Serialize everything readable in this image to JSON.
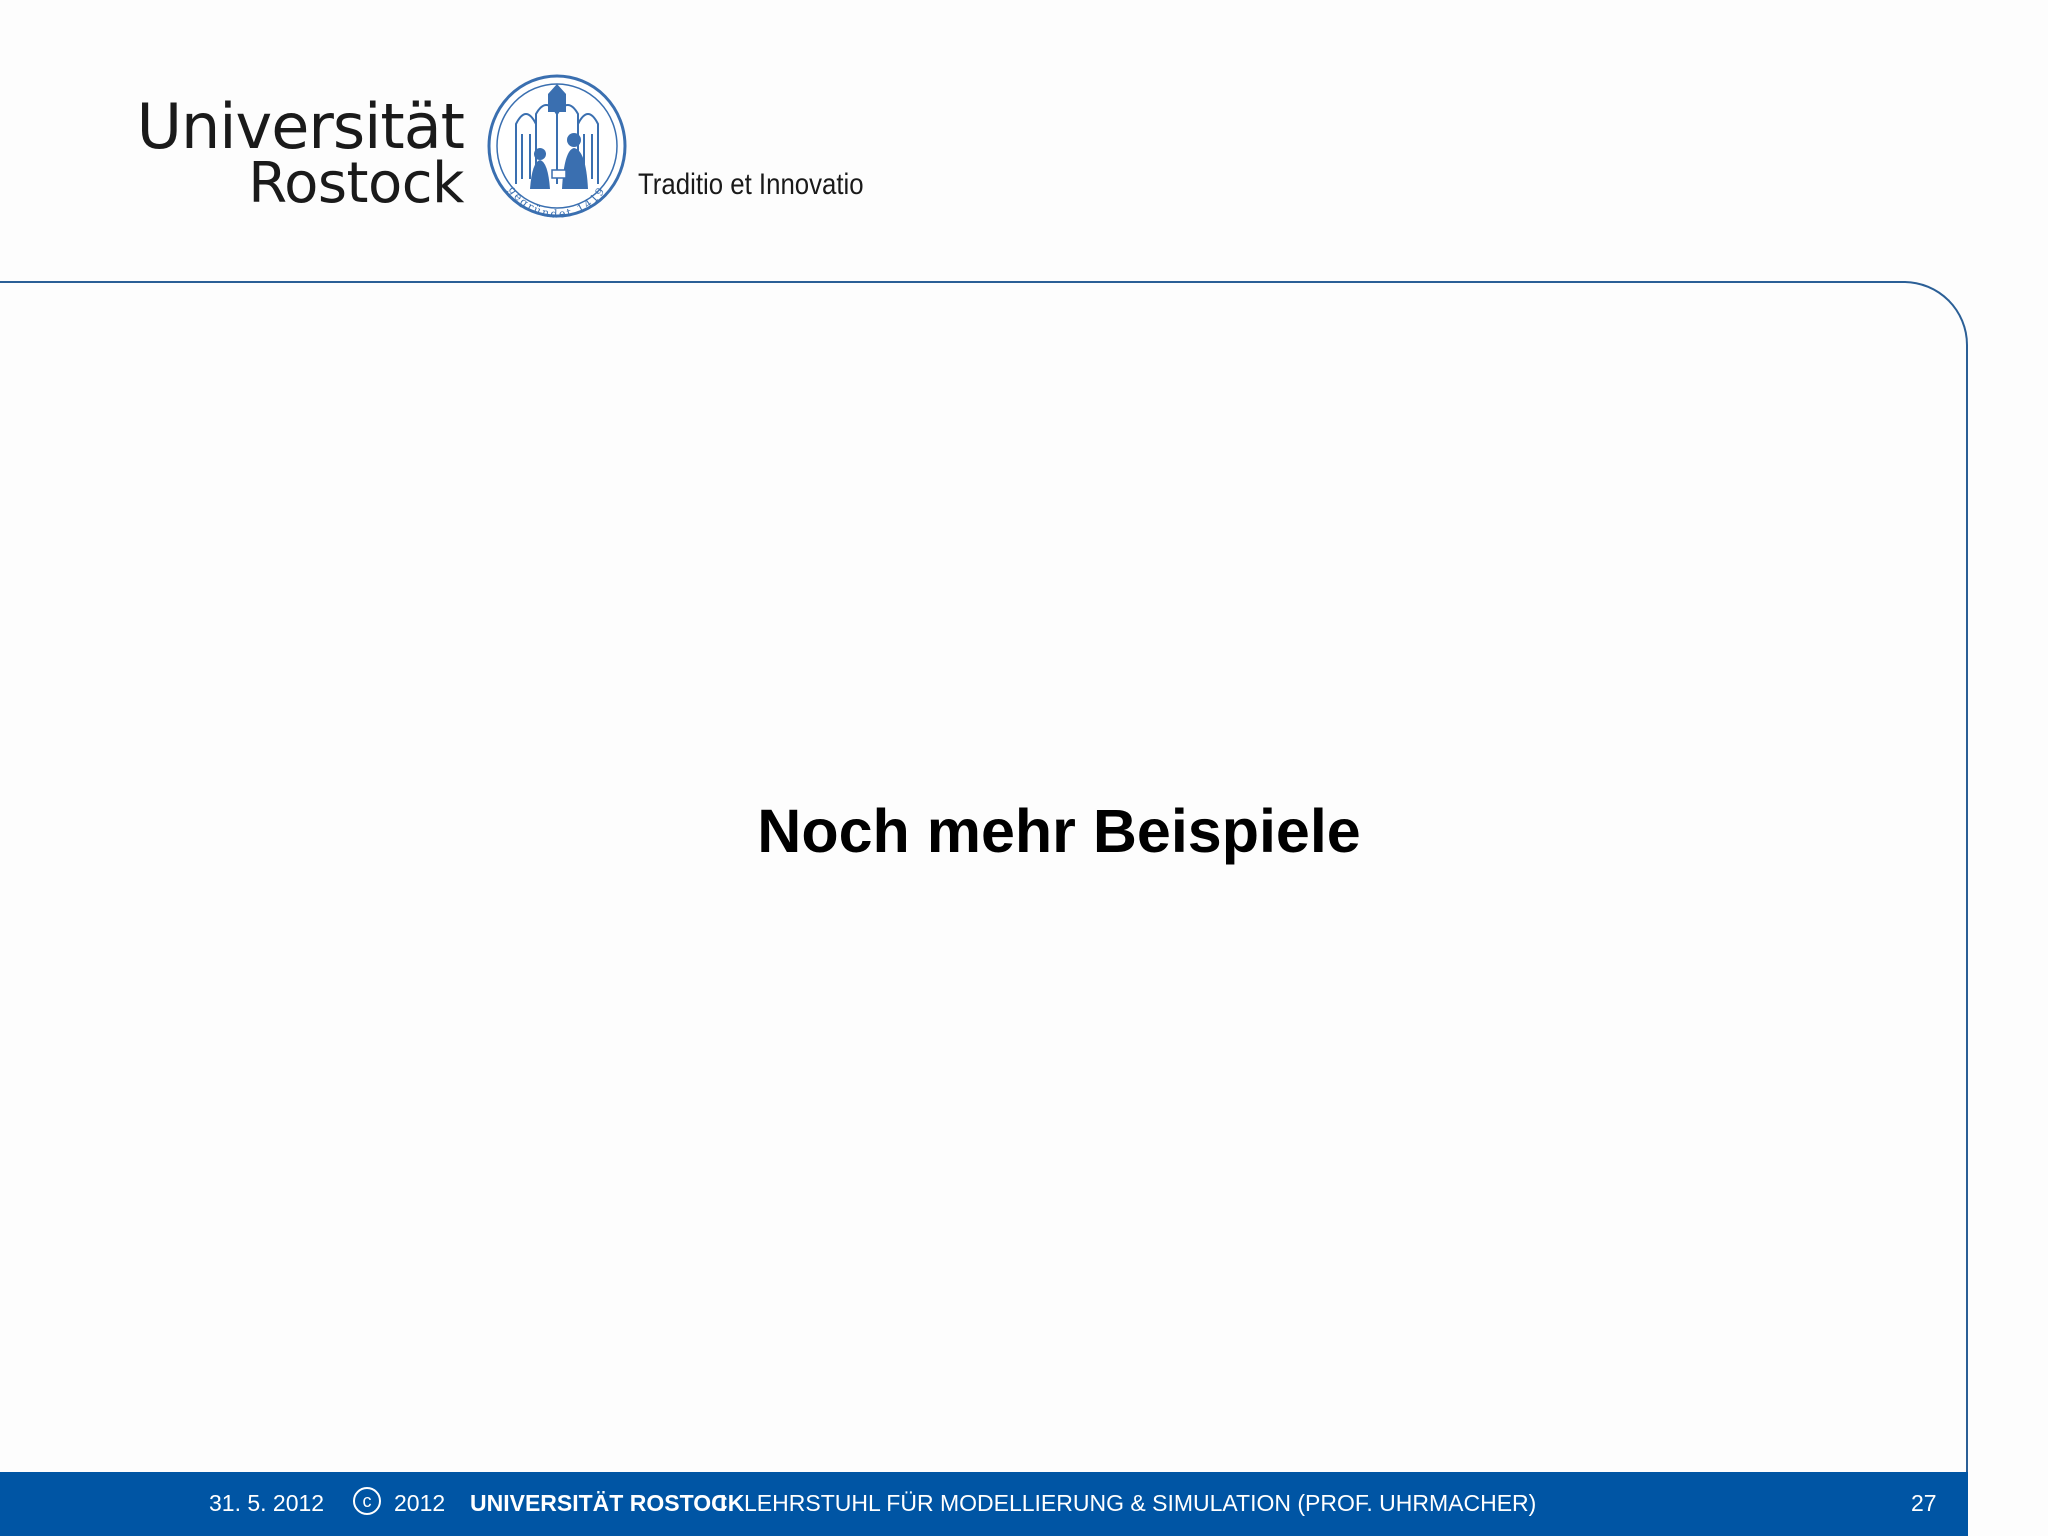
{
  "header": {
    "logo_line1": "Universität",
    "logo_line2": "Rostock",
    "seal_inscription": "gegründet 1419",
    "motto": "Traditio et Innovatio"
  },
  "slide": {
    "title": "Noch mehr Beispiele"
  },
  "footer": {
    "date": "31. 5. 2012",
    "copyright_symbol": "c",
    "year": "2012",
    "university": "UNIVERSITÄT ROSTOCK",
    "separator": "I",
    "chair": "LEHRSTUHL FÜR MODELLIERUNG & SIMULATION (PROF. UHRMACHER)",
    "page_number": "27"
  },
  "colors": {
    "brand_blue": "#0055a4",
    "frame_line": "#2b5f96",
    "seal_blue": "#3a6fb0",
    "background": "#fdfdfd"
  }
}
